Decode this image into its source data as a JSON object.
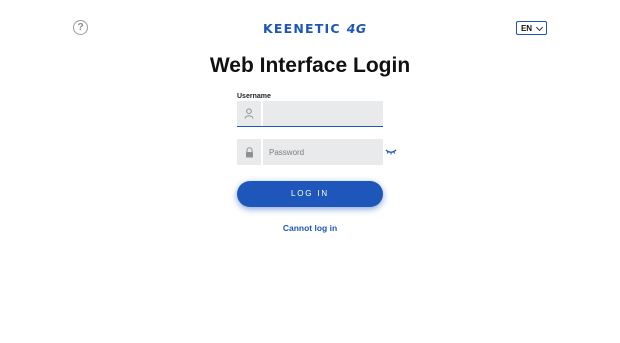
{
  "header": {
    "help_icon": "question-circle-icon",
    "help_glyph": "?",
    "logo_brand": "KEENETIC",
    "logo_model": "4G",
    "language": "EN",
    "language_icon": "chevron-down-icon"
  },
  "page": {
    "title": "Web Interface Login"
  },
  "form": {
    "username_label": "Username",
    "username_value": "",
    "username_icon": "user-icon",
    "password_placeholder": "Password",
    "password_value": "",
    "password_icon": "lock-icon",
    "password_toggle_icon": "eye-closed-icon",
    "login_label": "LOG IN",
    "cannot_login_link": "Cannot log in"
  },
  "colors": {
    "accent": "#1d56b8",
    "field_background": "#e9eaec"
  }
}
